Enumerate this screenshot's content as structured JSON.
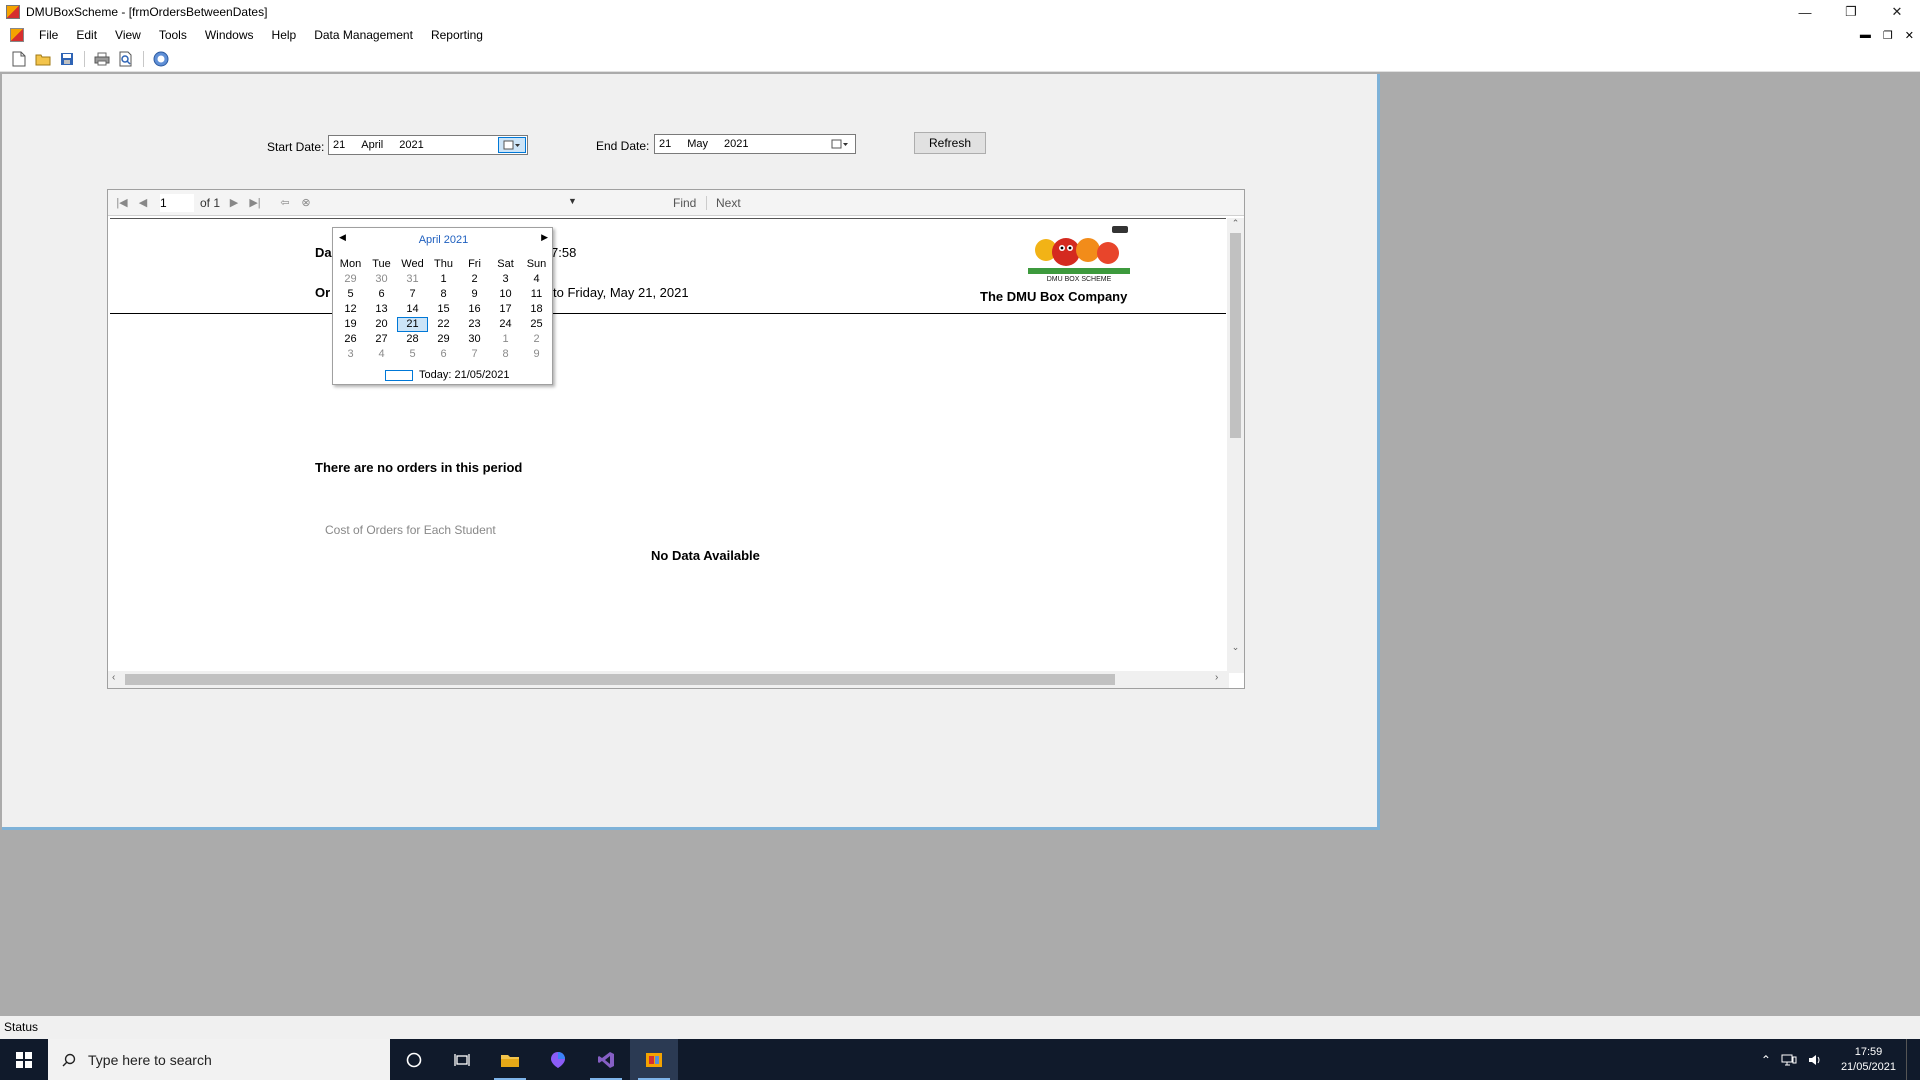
{
  "window": {
    "title": "DMUBoxScheme - [frmOrdersBetweenDates]"
  },
  "menu": {
    "items": [
      "File",
      "Edit",
      "View",
      "Tools",
      "Windows",
      "Help",
      "Data Management",
      "Reporting"
    ]
  },
  "form": {
    "start_label": "Start Date:",
    "start_date": {
      "day": "21",
      "month": "April",
      "year": "2021"
    },
    "end_label": "End Date:",
    "end_date": {
      "day": "21",
      "month": "May",
      "year": "2021"
    },
    "refresh_label": "Refresh"
  },
  "report_viewer": {
    "page": "1",
    "of_label": "of 1",
    "find_label": "Find",
    "next_label": "Next",
    "header_date_prefix": "Da",
    "header_time_suffix": "7:58",
    "header_orders_prefix": "Or",
    "header_range_text": "to Friday, May 21, 2021",
    "company_name": "The DMU Box Company",
    "logo_caption": "DMU BOX SCHEME",
    "no_orders_text": "There are no orders in this period",
    "chart_title": "Cost of Orders for Each Student",
    "no_data_text": "No Data Available"
  },
  "calendar": {
    "month_label": "April 2021",
    "weekdays": [
      "Mon",
      "Tue",
      "Wed",
      "Thu",
      "Fri",
      "Sat",
      "Sun"
    ],
    "weeks": [
      [
        "29",
        "30",
        "31",
        "1",
        "2",
        "3",
        "4"
      ],
      [
        "5",
        "6",
        "7",
        "8",
        "9",
        "10",
        "11"
      ],
      [
        "12",
        "13",
        "14",
        "15",
        "16",
        "17",
        "18"
      ],
      [
        "19",
        "20",
        "21",
        "22",
        "23",
        "24",
        "25"
      ],
      [
        "26",
        "27",
        "28",
        "29",
        "30",
        "1",
        "2"
      ],
      [
        "3",
        "4",
        "5",
        "6",
        "7",
        "8",
        "9"
      ]
    ],
    "selected_day": "21",
    "today_label": "Today: 21/05/2021"
  },
  "status": {
    "text": "Status"
  },
  "taskbar": {
    "search_placeholder": "Type here to search",
    "time": "17:59",
    "date": "21/05/2021"
  }
}
